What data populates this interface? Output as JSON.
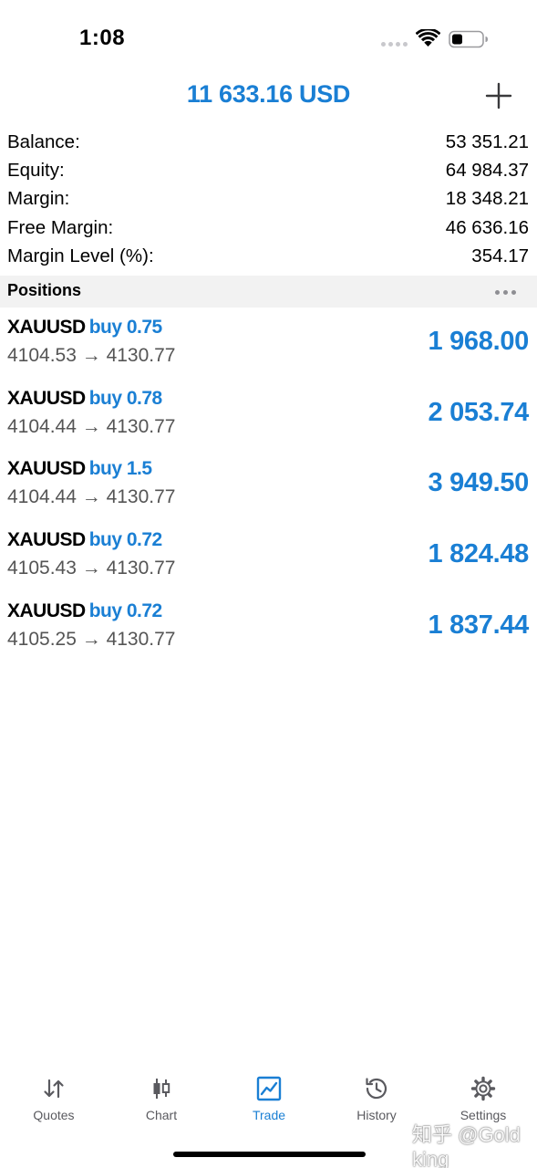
{
  "status_bar": {
    "time": "1:08"
  },
  "header": {
    "title": "11 633.16 USD"
  },
  "summary": [
    {
      "label": "Balance:",
      "value": "53 351.21"
    },
    {
      "label": "Equity:",
      "value": "64 984.37"
    },
    {
      "label": "Margin:",
      "value": "18 348.21"
    },
    {
      "label": "Free Margin:",
      "value": "46 636.16"
    },
    {
      "label": "Margin Level (%):",
      "value": "354.17"
    }
  ],
  "positions_section": {
    "title": "Positions"
  },
  "positions": [
    {
      "symbol": "XAUUSD",
      "type": "buy 0.75",
      "prices": "4104.53 → 4130.77",
      "profit": "1 968.00"
    },
    {
      "symbol": "XAUUSD",
      "type": "buy 0.78",
      "prices": "4104.44 → 4130.77",
      "profit": "2 053.74"
    },
    {
      "symbol": "XAUUSD",
      "type": "buy 1.5",
      "prices": "4104.44 → 4130.77",
      "profit": "3 949.50"
    },
    {
      "symbol": "XAUUSD",
      "type": "buy 0.72",
      "prices": "4105.43 → 4130.77",
      "profit": "1 824.48"
    },
    {
      "symbol": "XAUUSD",
      "type": "buy 0.72",
      "prices": "4105.25 → 4130.77",
      "profit": "1 837.44"
    }
  ],
  "tabs": [
    {
      "label": "Quotes",
      "icon": "quotes-arrows-icon",
      "active": false
    },
    {
      "label": "Chart",
      "icon": "candlestick-chart-icon",
      "active": false
    },
    {
      "label": "Trade",
      "icon": "trade-chart-icon",
      "active": true
    },
    {
      "label": "History",
      "icon": "history-clock-icon",
      "active": false
    },
    {
      "label": "Settings",
      "icon": "gear-icon",
      "active": false
    }
  ],
  "watermark": "知乎 @Gold king",
  "colors": {
    "accent": "#1a7fd4",
    "section_bg": "#f2f2f2",
    "inactive": "#5a5a5f"
  }
}
